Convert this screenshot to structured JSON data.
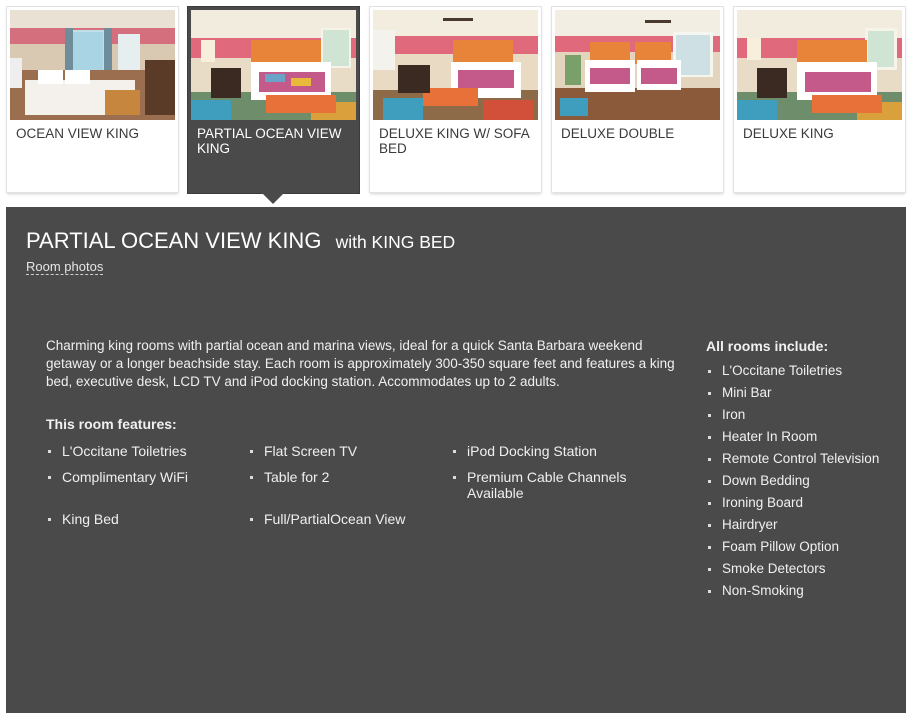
{
  "tabs": [
    {
      "label": "OCEAN VIEW KING",
      "active": false
    },
    {
      "label": "PARTIAL OCEAN VIEW KING",
      "active": true
    },
    {
      "label": "DELUXE KING w/ SOFA BED",
      "active": false
    },
    {
      "label": "DELUXE DOUBLE",
      "active": false
    },
    {
      "label": "DELUXE KING",
      "active": false
    }
  ],
  "room": {
    "title": "PARTIAL OCEAN VIEW KING",
    "bed": "with KING BED",
    "photos_link": "Room photos",
    "description": "Charming king rooms with partial ocean and marina views, ideal for a quick Santa Barbara weekend getaway or a longer beachside stay. Each room is approximately 300-350 square feet and features a king bed, executive desk, LCD TV and iPod docking station. Accommodates up to 2 adults.",
    "features_title": "This room features:",
    "features": [
      "L'Occitane Toiletries",
      "Flat Screen TV",
      "iPod Docking Station",
      "Complimentary WiFi",
      "Table for 2",
      "Premium Cable Channels Available",
      "King Bed",
      "Full/PartialOcean View"
    ],
    "includes_title": "All rooms include:",
    "includes": [
      "L'Occitane Toiletries",
      "Mini Bar",
      "Iron",
      "Heater In Room",
      "Remote Control Television",
      "Down Bedding",
      "Ironing Board",
      "Hairdryer",
      "Foam Pillow Option",
      "Smoke Detectors",
      "Non-Smoking"
    ]
  },
  "colors": {
    "panel_bg": "#4a4a4a",
    "wall_pink": "#e06a7c",
    "headboard_orange": "#e8843a",
    "wood": "#8a5a3a"
  }
}
